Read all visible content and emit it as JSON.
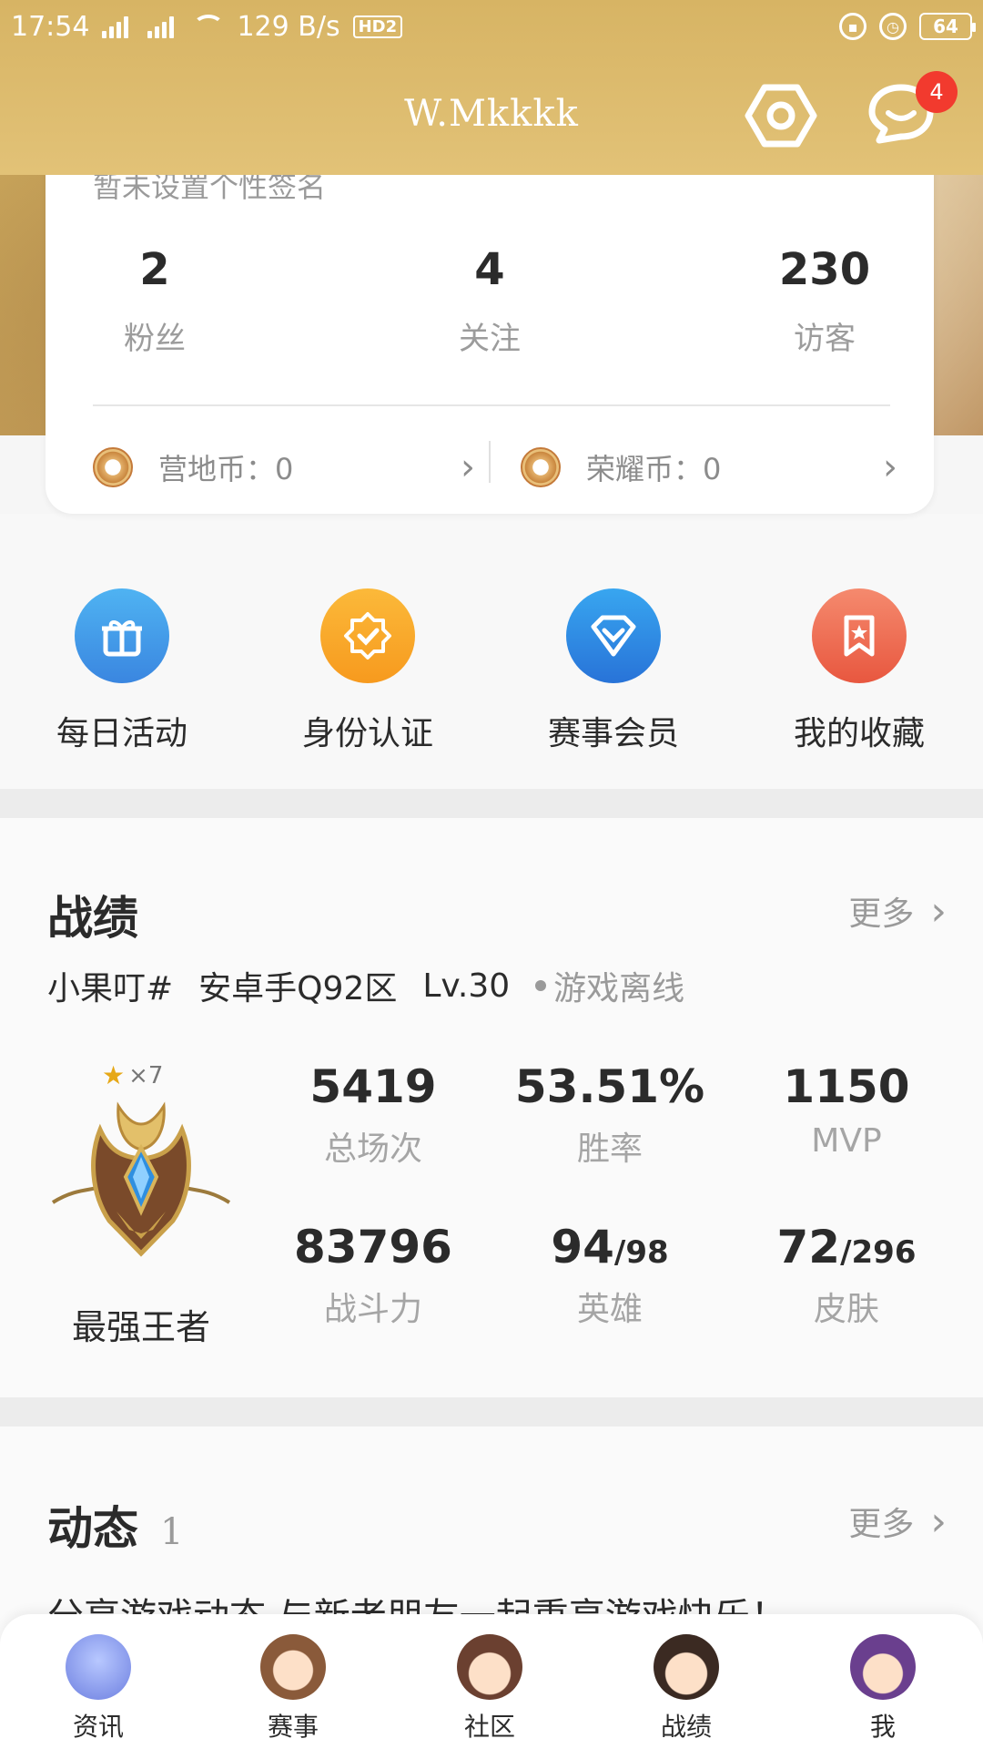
{
  "status_bar": {
    "time": "17:54",
    "network_speed": "129 B/s",
    "battery": "64",
    "hd_label": "HD2",
    "net_types": [
      "4G",
      "4G"
    ]
  },
  "header": {
    "title": "W.Mkkkk",
    "message_badge": "4"
  },
  "profile": {
    "signature": "暂未设置个性签名",
    "stats": [
      {
        "value": "2",
        "label": "粉丝"
      },
      {
        "value": "4",
        "label": "关注"
      },
      {
        "value": "230",
        "label": "访客"
      }
    ],
    "coins": [
      {
        "label": "营地币：0"
      },
      {
        "label": "荣耀币：0"
      }
    ]
  },
  "actions": [
    {
      "label": "每日活动",
      "icon": "gift-icon",
      "color": "#3f9be8"
    },
    {
      "label": "身份认证",
      "icon": "verified-badge-icon",
      "color": "#f7a727"
    },
    {
      "label": "赛事会员",
      "icon": "diamond-icon",
      "color": "#2f8fe0"
    },
    {
      "label": "我的收藏",
      "icon": "bookmark-icon",
      "color": "#ee6b52"
    }
  ],
  "record": {
    "title": "战绩",
    "more": "更多",
    "player_name": "小果叮#",
    "server": "安卓手Q92区",
    "level": "Lv.30",
    "status": "游戏离线",
    "star_count": "×7",
    "rank_name": "最强王者",
    "stats": [
      {
        "value": "5419",
        "label": "总场次"
      },
      {
        "value": "53.51%",
        "label": "胜率"
      },
      {
        "value": "1150",
        "label": "MVP"
      },
      {
        "value": "83796",
        "label": "战斗力"
      },
      {
        "value": "94",
        "sub": "/98",
        "label": "英雄"
      },
      {
        "value": "72",
        "sub": "/296",
        "label": "皮肤"
      }
    ]
  },
  "feed": {
    "title": "动态",
    "count": "1",
    "more": "更多",
    "preview": "分享游戏动态  与新老朋友一起重享游戏快乐！"
  },
  "tabs": [
    {
      "label": "资讯"
    },
    {
      "label": "赛事"
    },
    {
      "label": "社区"
    },
    {
      "label": "战绩"
    },
    {
      "label": "我"
    }
  ],
  "colors": {
    "header_gold": "#d7b464",
    "badge_red": "#f23a2e"
  }
}
